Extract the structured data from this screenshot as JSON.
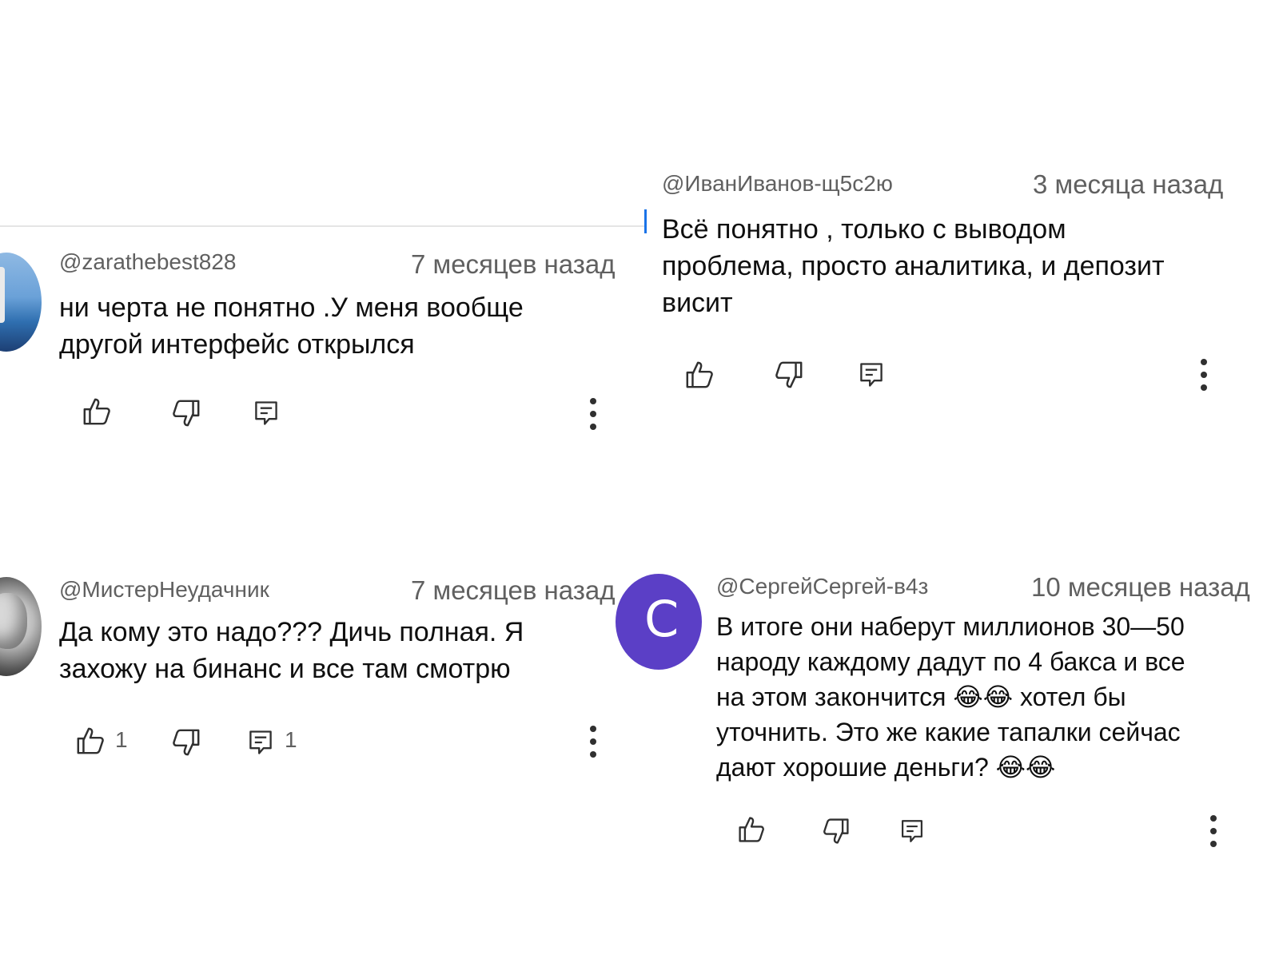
{
  "comments": [
    {
      "username": "@zarathebest828",
      "time": "7 месяцев назад",
      "lines": [
        "ни черта не понятно .У меня вообще",
        "другой интерфейс открылся"
      ],
      "like_count": "",
      "reply_count": ""
    },
    {
      "username": "@ИванИванов-щ5с2ю",
      "time": "3 месяца назад",
      "lines": [
        "Всё  понятно , только с выводом",
        "проблема, просто аналитика, и  депозит",
        "висит"
      ],
      "like_count": "",
      "reply_count": ""
    },
    {
      "username": "@МистерНеудачник",
      "time": "7 месяцев назад",
      "lines": [
        "Да кому это надо??? Дичь полная. Я",
        "захожу на бинанс и все там смотрю"
      ],
      "like_count": "1",
      "reply_count": "1"
    },
    {
      "username": "@СергейСергей-в4з",
      "time": "10 месяцев назад",
      "avatar_letter": "С",
      "lines": [
        "В итоге они наберут миллионов 30—50",
        "народу каждому дадут по 4 бакса и все",
        "на этом закончится 😂😂 хотел бы",
        "уточнить. Это же какие тапалки сейчас",
        "дают хорошие деньги? 😂😂"
      ],
      "like_count": "",
      "reply_count": ""
    }
  ],
  "colors": {
    "accent": "#1a73e8",
    "avatar_purple": "#5b3fc6",
    "meta_text": "#606060"
  },
  "icons": [
    "thumbs-up-icon",
    "thumbs-down-icon",
    "reply-icon",
    "more-vert-icon"
  ]
}
